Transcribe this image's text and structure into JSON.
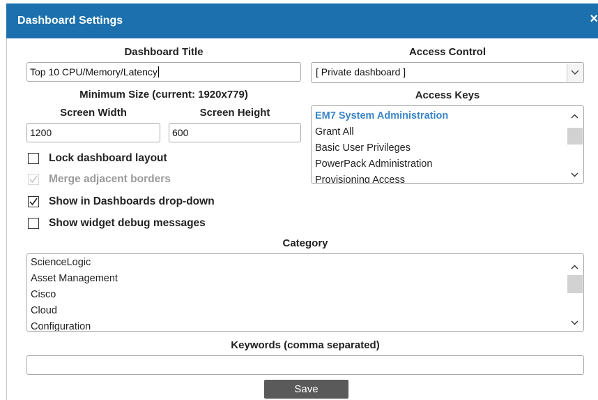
{
  "dialog": {
    "title": "Dashboard Settings",
    "close_glyph": "×"
  },
  "dashboard_title": {
    "label": "Dashboard Title",
    "value": "Top 10 CPU/Memory/Latency"
  },
  "min_size": {
    "label": "Minimum Size (current: 1920x779)",
    "width_label": "Screen Width",
    "width_value": "1200",
    "height_label": "Screen Height",
    "height_value": "600"
  },
  "checkboxes": [
    {
      "label": "Lock dashboard layout",
      "checked": false,
      "disabled": false
    },
    {
      "label": "Merge adjacent borders",
      "checked": true,
      "disabled": true
    },
    {
      "label": "Show in Dashboards drop-down",
      "checked": true,
      "disabled": false
    },
    {
      "label": "Show widget debug messages",
      "checked": false,
      "disabled": false
    }
  ],
  "access_control": {
    "label": "Access Control",
    "value": "[ Private dashboard ]"
  },
  "access_keys": {
    "label": "Access Keys",
    "items": [
      "EM7 System Administration",
      "Grant All",
      "Basic User Privileges",
      "PowerPack Administration",
      "Provisioning Access"
    ],
    "selected_index": 0
  },
  "category": {
    "label": "Category",
    "items": [
      "ScienceLogic",
      "Asset Management",
      "Cisco",
      "Cloud",
      "Configuration"
    ]
  },
  "keywords": {
    "label": "Keywords (comma separated)",
    "value": ""
  },
  "save_button": {
    "label": "Save"
  },
  "colors": {
    "titlebar": "#1b70ad",
    "selected_key": "#3a86c8",
    "button": "#5a5a5a"
  }
}
